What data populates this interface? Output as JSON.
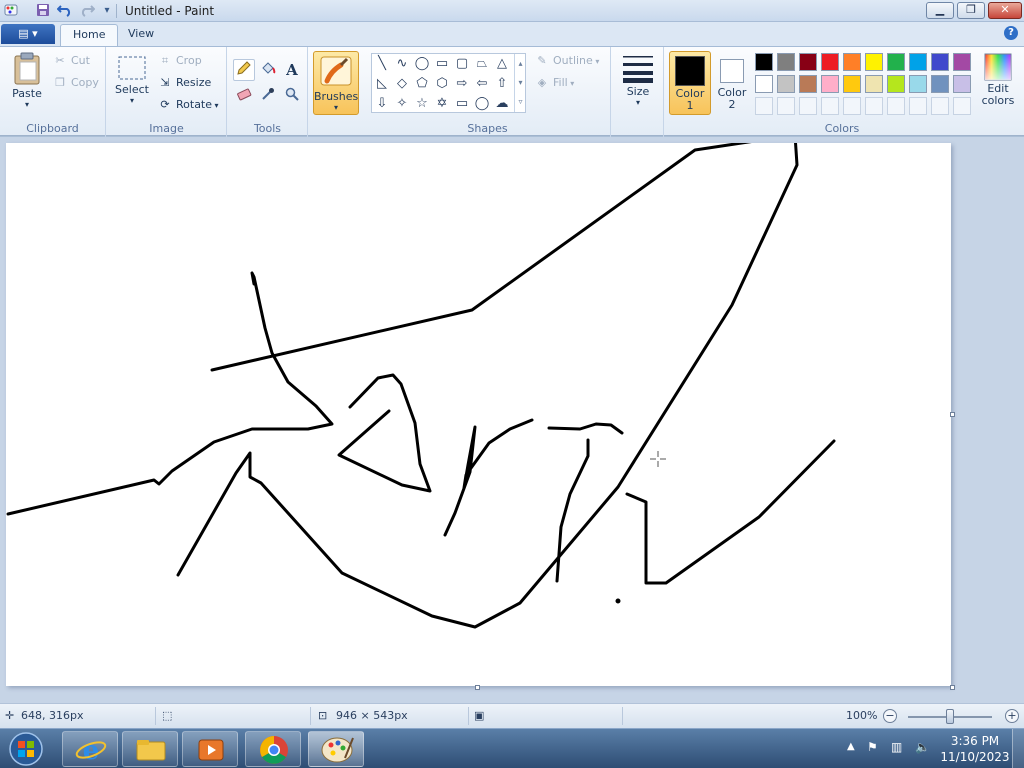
{
  "window": {
    "title": "Untitled - Paint",
    "minimize": "▁",
    "maximize": "❐",
    "close": "✕"
  },
  "quick_access": {
    "save": "save-icon",
    "undo": "undo-icon",
    "redo": "redo-icon",
    "customize": "▾"
  },
  "tabs": [
    {
      "label": "Home",
      "active": true
    },
    {
      "label": "View",
      "active": false
    }
  ],
  "help": "?",
  "clipboard": {
    "paste": "Paste",
    "cut": "Cut",
    "copy": "Copy",
    "label": "Clipboard"
  },
  "image": {
    "select": "Select",
    "crop": "Crop",
    "resize": "Resize",
    "rotate": "Rotate",
    "label": "Image"
  },
  "tools": {
    "label": "Tools",
    "text_glyph": "A"
  },
  "brushes": {
    "label": "Brushes"
  },
  "shapes": {
    "outline": "Outline",
    "fill": "Fill",
    "label": "Shapes"
  },
  "size": {
    "label": "Size"
  },
  "color1": {
    "line1": "Color",
    "line2": "1",
    "value": "#000000"
  },
  "color2": {
    "line1": "Color",
    "line2": "2",
    "value": "#ffffff"
  },
  "colors": {
    "label": "Colors",
    "edit_line1": "Edit",
    "edit_line2": "colors",
    "palette_row1": [
      "#000000",
      "#7f7f7f",
      "#880015",
      "#ed1c24",
      "#ff7f27",
      "#fff200",
      "#22b14c",
      "#00a2e8",
      "#3f48cc",
      "#a349a4"
    ],
    "palette_row2": [
      "#ffffff",
      "#c3c3c3",
      "#b97a57",
      "#ffaec9",
      "#ffc90e",
      "#efe4b0",
      "#b5e61d",
      "#99d9ea",
      "#7092be",
      "#c8bfe7"
    ]
  },
  "status": {
    "cursor_pos": "648, 316px",
    "canvas_size": "946 × 543px",
    "zoom": "100%",
    "zoom_minus": "−",
    "zoom_plus": "+"
  },
  "taskbar": {
    "time": "3:36 PM",
    "date": "11/10/2023"
  }
}
